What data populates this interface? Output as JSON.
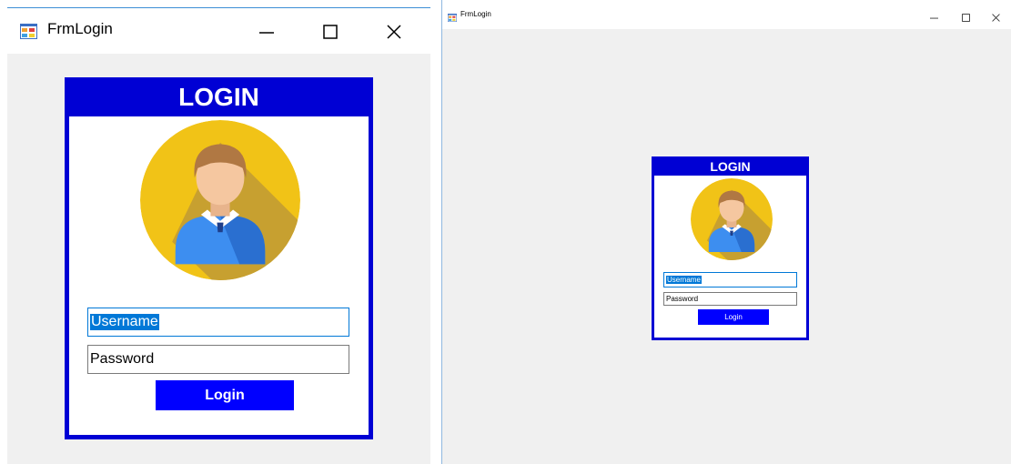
{
  "colors": {
    "card_blue": "#0000d4",
    "button_blue": "#0000ff",
    "selection": "#0078d7",
    "avatar_yellow": "#f1c317",
    "avatar_shadow": "#c7a030",
    "shirt": "#3d8ef0",
    "hair": "#b07843",
    "skin": "#f5c7a0",
    "window_bg": "#f0f0f0",
    "focus_border": "#0078d7"
  },
  "windows": [
    {
      "title": "FrmLogin",
      "icons": {
        "app": "winforms-app-icon",
        "minimize": "minimize-icon",
        "maximize": "maximize-icon",
        "close": "close-icon"
      },
      "login": {
        "header": "LOGIN",
        "username": "Username",
        "password": "Password",
        "button": "Login"
      }
    },
    {
      "title": "FrmLogin",
      "icons": {
        "app": "winforms-app-icon",
        "minimize": "minimize-icon",
        "maximize": "maximize-icon",
        "close": "close-icon"
      },
      "login": {
        "header": "LOGIN",
        "username": "Username",
        "password": "Password",
        "button": "Login"
      }
    }
  ]
}
